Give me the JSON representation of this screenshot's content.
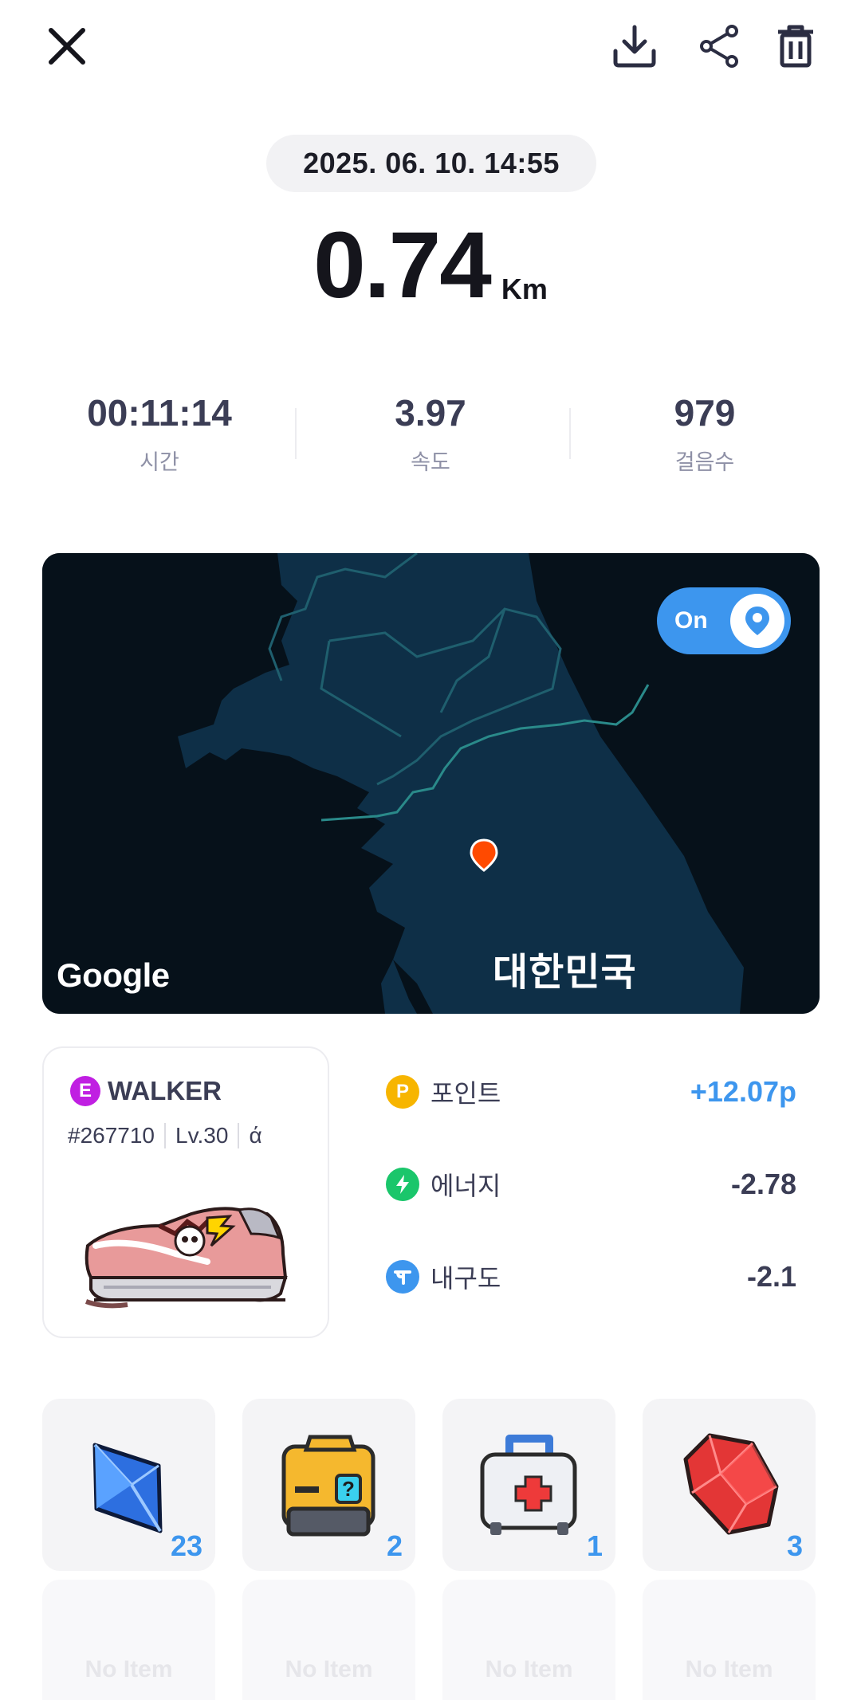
{
  "header": {
    "date": "2025. 06. 10. 14:55",
    "distance": "0.74",
    "distance_unit": "Km"
  },
  "toolbar": {
    "close_icon": "close-icon",
    "download_icon": "download-icon",
    "share_icon": "share-icon",
    "delete_icon": "trash-icon"
  },
  "stats": [
    {
      "value": "00:11:14",
      "label": "시간"
    },
    {
      "value": "3.97",
      "label": "속도"
    },
    {
      "value": "979",
      "label": "걸음수"
    }
  ],
  "map": {
    "toggle_label": "On",
    "country_label": "대한민국",
    "attribution": "Google",
    "colors": {
      "land": "#0e2f47",
      "sea": "#06111a",
      "border": "#2a8a8a",
      "pin": "#ff4a00",
      "toggle": "#3d96ee"
    }
  },
  "sneaker": {
    "rarity": "E",
    "type": "WALKER",
    "id": "#267710",
    "level": "Lv.30",
    "mint_glyph": "ά"
  },
  "rewards": [
    {
      "icon": "point-icon",
      "symbol": "P",
      "label": "포인트",
      "value": "+12.07p",
      "color": "#f7b500"
    },
    {
      "icon": "energy-icon",
      "symbol": "⚡",
      "label": "에너지",
      "value": "-2.78",
      "color": "#1ac66b"
    },
    {
      "icon": "durability-icon",
      "symbol": "T",
      "label": "내구도",
      "value": "-2.1",
      "color": "#3d96ee"
    }
  ],
  "items": [
    {
      "name": "blue-crystal",
      "count": "23"
    },
    {
      "name": "mystery-box",
      "count": "2"
    },
    {
      "name": "repair-kit",
      "count": "1"
    },
    {
      "name": "red-gem",
      "count": "3"
    }
  ],
  "empty_items": [
    "No Item",
    "No Item",
    "No Item",
    "No Item"
  ]
}
